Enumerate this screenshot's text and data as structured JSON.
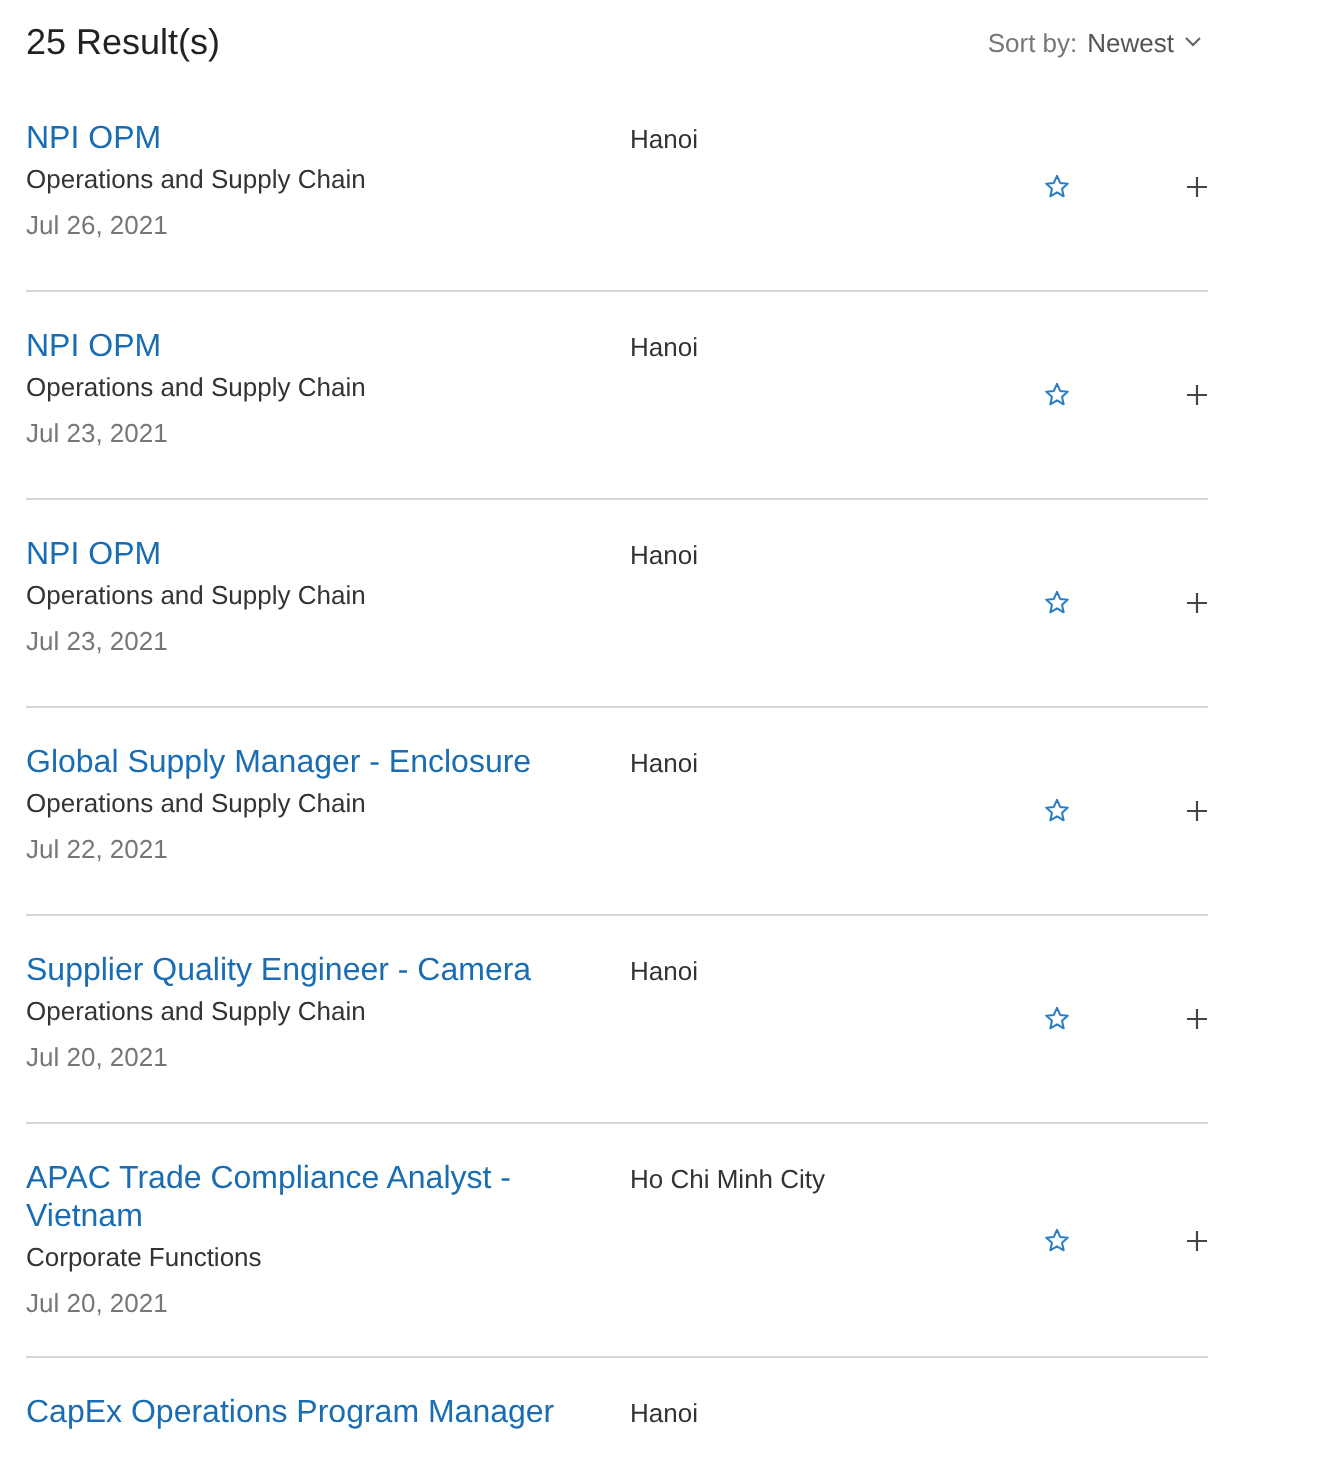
{
  "results_count": "25 Result(s)",
  "sort": {
    "label": "Sort by:",
    "value": "Newest"
  },
  "jobs": [
    {
      "title": "NPI OPM",
      "team": "Operations and Supply Chain",
      "date": "Jul 26, 2021",
      "location": "Hanoi"
    },
    {
      "title": "NPI OPM",
      "team": "Operations and Supply Chain",
      "date": "Jul 23, 2021",
      "location": "Hanoi"
    },
    {
      "title": "NPI OPM",
      "team": "Operations and Supply Chain",
      "date": "Jul 23, 2021",
      "location": "Hanoi"
    },
    {
      "title": "Global Supply Manager - Enclosure",
      "team": "Operations and Supply Chain",
      "date": "Jul 22, 2021",
      "location": "Hanoi"
    },
    {
      "title": "Supplier Quality Engineer - Camera",
      "team": "Operations and Supply Chain",
      "date": "Jul 20, 2021",
      "location": "Hanoi"
    },
    {
      "title": "APAC Trade Compliance Analyst - Vietnam",
      "team": "Corporate Functions",
      "date": "Jul 20, 2021",
      "location": "Ho Chi Minh City"
    },
    {
      "title": "CapEx Operations Program Manager",
      "location": "Hanoi"
    }
  ]
}
